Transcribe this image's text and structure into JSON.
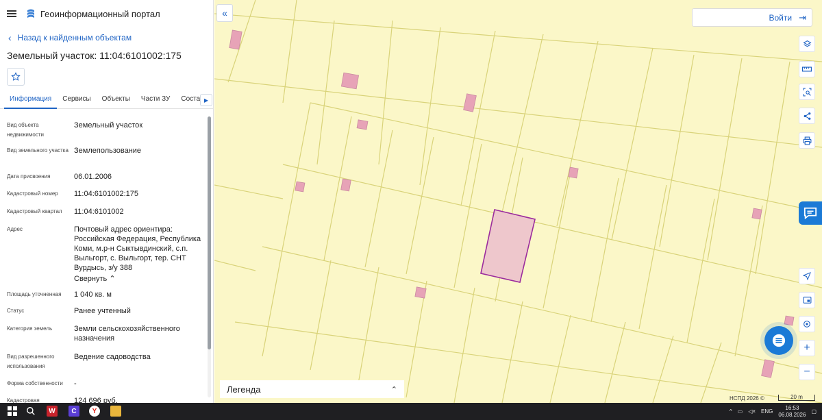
{
  "header": {
    "brand": "Геоинформационный портал"
  },
  "nav": {
    "back_label": "Назад к найденным объектам"
  },
  "object": {
    "title": "Земельный участок: 11:04:6101002:175"
  },
  "tabs": [
    {
      "label": "Информация"
    },
    {
      "label": "Сервисы"
    },
    {
      "label": "Объекты"
    },
    {
      "label": "Части ЗУ"
    },
    {
      "label": "Состав"
    }
  ],
  "properties": [
    {
      "key": "Вид объекта недвижимости",
      "value": "Земельный участок"
    },
    {
      "key": "Вид земельного участка",
      "value": "Землепользование"
    },
    {
      "key": "Дата присвоения",
      "value": "06.01.2006"
    },
    {
      "key": "Кадастровый номер",
      "value": "11:04:6101002:175"
    },
    {
      "key": "Кадастровый квартал",
      "value": "11:04:6101002"
    },
    {
      "key": "Адрес",
      "value": "Почтовый адрес ориентира: Российская Федерация, Республика Коми, м.р-н Сыктывдинский, с.п. Выльгорт, с. Выльгорт, тер. СНТ Вурдысь, з/у 388"
    },
    {
      "key": "Площадь уточненная",
      "value": "1 040 кв. м"
    },
    {
      "key": "Статус",
      "value": "Ранее учтенный"
    },
    {
      "key": "Категория земель",
      "value": "Земли сельскохозяйственного назначения"
    },
    {
      "key": "Вид разрешенного использования",
      "value": "Ведение садоводства"
    },
    {
      "key": "Форма собственности",
      "value": "-"
    },
    {
      "key": "Кадастровая",
      "value": "124 696 руб."
    }
  ],
  "address_toggle": "Свернуть",
  "map": {
    "login_label": "Войти",
    "legend_label": "Легенда",
    "attribution": "НСПД 2026 ©",
    "scale_label": "20 m",
    "colors": {
      "background": "#fbf7c8",
      "parcel_line": "#d9d37a",
      "building": "#e7a3b7",
      "selected": "#9b2c9d"
    }
  },
  "taskbar": {
    "lang": "ENG",
    "time": "16:53",
    "date": "06.08.2026"
  }
}
